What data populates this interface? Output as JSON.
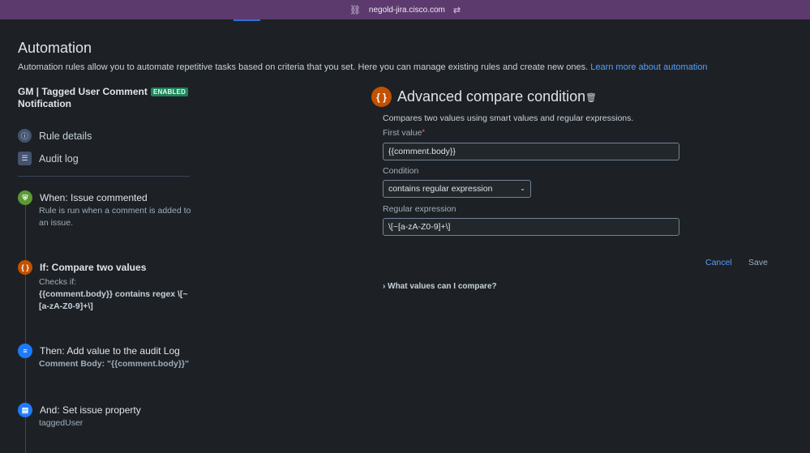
{
  "browser": {
    "url": "negold-jira.cisco.com",
    "link_icon": "link-icon",
    "settings_icon": "adjust-icon"
  },
  "header": {
    "title": "Automation",
    "description": "Automation rules allow you to automate repetitive tasks based on criteria that you set. Here you can manage existing rules and create new ones.",
    "learn_more": "Learn more about automation"
  },
  "rule": {
    "name": "GM | Tagged User Comment Notification",
    "status": "ENABLED"
  },
  "nav": {
    "rule_details": "Rule details",
    "audit_log": "Audit log"
  },
  "components": {
    "trigger": {
      "title": "When: Issue commented",
      "subtitle": "Rule is run when a comment is added to an issue.",
      "icon": "shield-icon",
      "color": "#5b9a33"
    },
    "condition": {
      "title": "If: Compare two values",
      "subtitle_prefix": "Checks if:",
      "subtitle_detail": "{{comment.body}} contains regex \\[~[a-zA-Z0-9]+\\]",
      "icon": "braces-icon",
      "color": "#c25100"
    },
    "action1": {
      "title": "Then: Add value to the audit Log",
      "subtitle": "Comment Body: \"{{comment.body}}\"",
      "icon": "list-icon",
      "color": "#1d7afc"
    },
    "action2": {
      "title": "And: Set issue property",
      "subtitle": "taggedUser",
      "icon": "document-icon",
      "color": "#1d7afc"
    }
  },
  "panel": {
    "title": "Advanced compare condition",
    "icon_glyph": "{ }",
    "description": "Compares two values using smart values and regular expressions.",
    "first_value_label": "First value",
    "first_value": "{{comment.body}}",
    "condition_label": "Condition",
    "condition_value": "contains regular expression",
    "regex_label": "Regular expression",
    "regex_value": "\\[~[a-zA-Z0-9]+\\]",
    "cancel": "Cancel",
    "save": "Save",
    "what_values": "What values can I compare?"
  }
}
